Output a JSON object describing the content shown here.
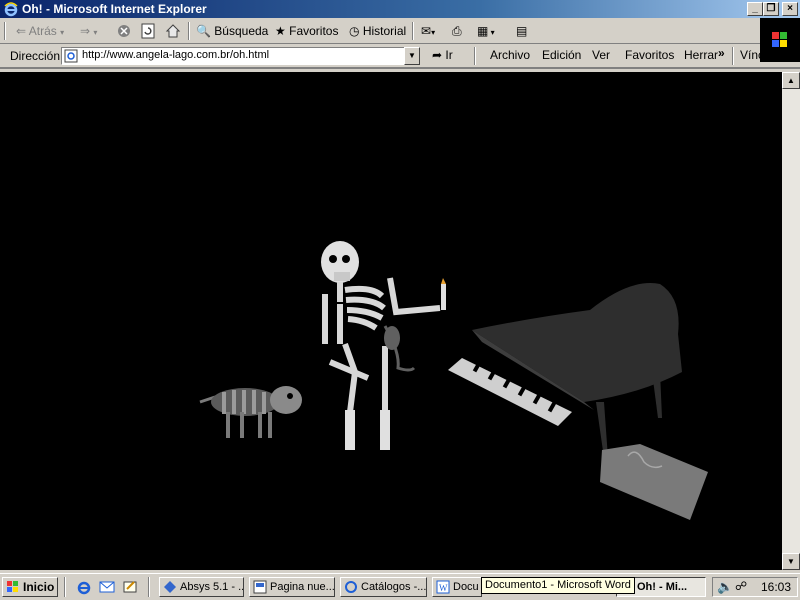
{
  "window": {
    "title": "Oh! - Microsoft Internet Explorer",
    "controls": {
      "minimize": "_",
      "restore": "❐",
      "close": "×"
    }
  },
  "toolbar": {
    "back": "Atrás",
    "search": "Búsqueda",
    "favorites": "Favoritos",
    "history": "Historial"
  },
  "address_bar": {
    "label": "Dirección",
    "url": "http://www.angela-lago.com.br/oh.html",
    "go": "Ir"
  },
  "menu": {
    "items": [
      "Archivo",
      "Edición",
      "Ver",
      "Favoritos",
      "Herrar"
    ],
    "overflow": "»",
    "links": "Vínculos",
    "links_overflow": "»"
  },
  "taskbar": {
    "start": "Inicio",
    "tasks": [
      {
        "label": "Absys 5.1 - ..."
      },
      {
        "label": "Pagina nue..."
      },
      {
        "label": "Catálogos -..."
      },
      {
        "label": "Docu"
      },
      {
        "label": "Oh! - Mi..."
      }
    ],
    "clock": "16:03",
    "tooltip": "Documento1 - Microsoft Word"
  },
  "colors": {
    "title_gradient_start": "#0a246a",
    "title_gradient_end": "#a6caf0",
    "content_background": "#000000",
    "chrome": "#d4d0c8"
  }
}
